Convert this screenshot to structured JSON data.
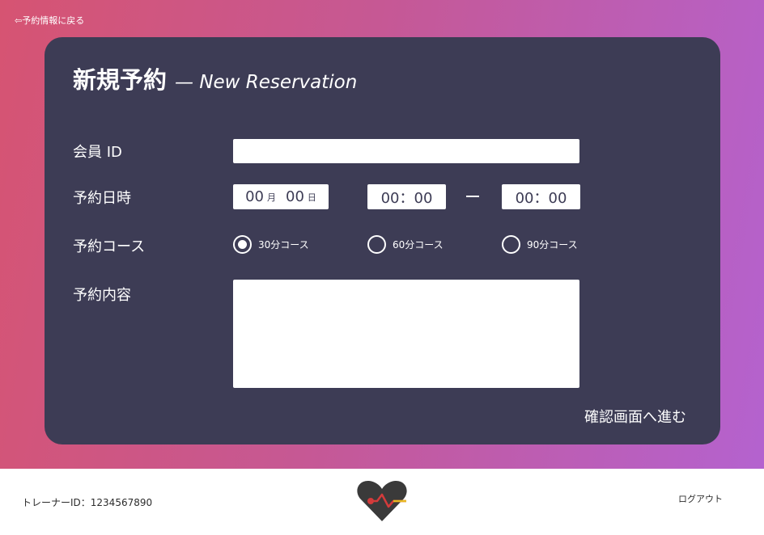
{
  "nav": {
    "back_label": "⇦予約情報に戻る"
  },
  "form": {
    "title_ja": "新規予約",
    "title_en": "— New Reservation",
    "member_id": {
      "label": "会員 ID",
      "value": ""
    },
    "datetime": {
      "label": "予約日時",
      "month": "00",
      "month_unit": "月",
      "day": "00",
      "day_unit": "日",
      "start_time": "00：00",
      "end_time": "00：00"
    },
    "course": {
      "label": "予約コース",
      "options": [
        {
          "label": "30分コース",
          "selected": true
        },
        {
          "label": "60分コース",
          "selected": false
        },
        {
          "label": "90分コース",
          "selected": false
        }
      ]
    },
    "content": {
      "label": "予約内容",
      "value": ""
    },
    "submit_label": "確認画面へ進む"
  },
  "footer": {
    "trainer_id_label": "トレーナーID：1234567890",
    "logout_label": "ログアウト",
    "logo_icon": "heart-pulse-logo-icon"
  },
  "colors": {
    "gradient_start": "#d65472",
    "gradient_end": "#b462cf",
    "card": "#3d3c55",
    "logo_dark": "#3a3a3a",
    "logo_red": "#d33b3b",
    "logo_yellow": "#e8b923"
  }
}
